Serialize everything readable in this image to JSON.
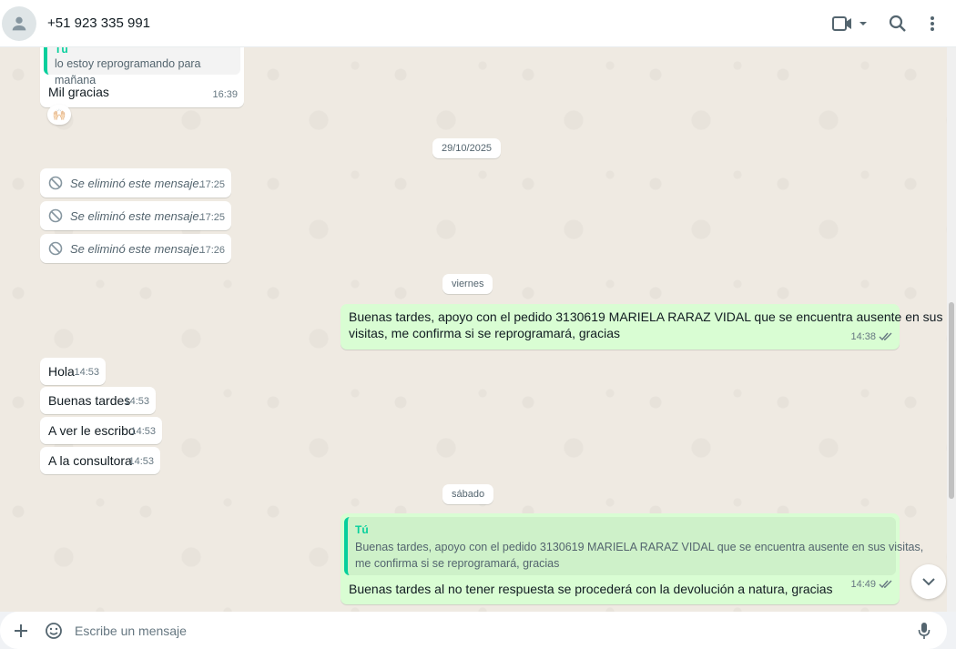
{
  "header": {
    "contact_name": "+51 923 335 991",
    "icons": [
      "avatar-person-icon",
      "video-call-icon",
      "chevron-down-icon",
      "search-icon",
      "more-vertical-icon"
    ]
  },
  "messages": {
    "m1": {
      "quote_name": "Tú",
      "quote_text": "lo estoy reprogramando para mañana",
      "text": "Mil gracias",
      "time": "16:39",
      "reaction": "🙌🏻"
    },
    "chip1": "29/10/2025",
    "deleted": [
      {
        "text": "Se eliminó este mensaje.",
        "time": "17:25"
      },
      {
        "text": "Se eliminó este mensaje.",
        "time": "17:25"
      },
      {
        "text": "Se eliminó este mensaje.",
        "time": "17:26"
      }
    ],
    "chip2": "viernes",
    "out1": {
      "line1": "Buenas tardes, apoyo con el pedido 3130619 MARIELA RARAZ VIDAL que se encuentra ausente en sus",
      "line2": "visitas, me confirma si se reprogramará, gracias",
      "time": "14:38"
    },
    "in_list": [
      {
        "text": "Hola",
        "time": "14:53"
      },
      {
        "text": "Buenas tardes",
        "time": "14:53"
      },
      {
        "text": "A ver le escribo",
        "time": "14:53"
      },
      {
        "text": "A la consultora",
        "time": "14:53"
      }
    ],
    "chip3": "sábado",
    "out2": {
      "quote_name": "Tú",
      "quote_line1": "Buenas tardes, apoyo con el pedido 3130619 MARIELA RARAZ VIDAL que se encuentra ausente en sus visitas,",
      "quote_line2": "me confirma si se reprogramará, gracias",
      "text": "Buenas tardes al no tener respuesta se procederá con la devolución a natura, gracias",
      "time": "14:49"
    }
  },
  "composer": {
    "placeholder": "Escribe un mensaje",
    "icons": [
      "plus-icon",
      "sticker-icon",
      "microphone-icon"
    ]
  },
  "colors": {
    "outgoing_bubble": "#d9fdd3",
    "incoming_bubble": "#ffffff",
    "chat_background": "#efeae2",
    "quote_accent": "#06cf9c",
    "read_ticks": "#53bdeb"
  }
}
